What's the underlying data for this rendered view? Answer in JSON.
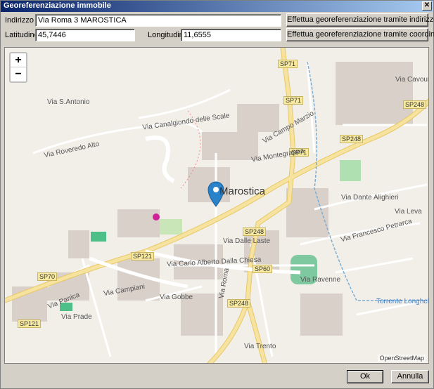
{
  "window": {
    "title": "Georeferenziazione immobile",
    "close_glyph": "✕"
  },
  "form": {
    "address_label": "Indirizzo",
    "address_value": "Via Roma 3 MAROSTICA",
    "lat_label": "Latitudine",
    "lat_value": "45,7446",
    "lon_label": "Longitudine",
    "lon_value": "11,6555",
    "geocode_address_button": "Effettua georeferenziazione tramite indirizzo",
    "geocode_coords_button": "Effettua georeferenziazione tramite coordinate"
  },
  "map": {
    "zoom_in": "+",
    "zoom_out": "−",
    "town": "Marostica",
    "attribution": "OpenStreetMap",
    "shields": [
      "SP71",
      "SP71",
      "SP71",
      "SP248",
      "SP248",
      "SP248",
      "SP248",
      "SP121",
      "SP121",
      "SP60",
      "SP70",
      "SP248"
    ],
    "streets": [
      "Via Roveredo Alto",
      "Via Canalgiondo delle Scale",
      "Via Panica",
      "Via Campiani",
      "Via Carlo Alberto Dalla Chiesa",
      "Via Roma",
      "Via Dalle Laste",
      "Via Montegrappa",
      "Via Campo Marzio",
      "Via Dante Alighieri",
      "Via Francesco Petrarca",
      "Via Leva",
      "Via Ravenne",
      "Via S.Antonio",
      "Via Cavour",
      "Torrente Longhella",
      "Via Gobbe",
      "Via Prade",
      "Via Trento"
    ],
    "colors": {
      "background": "#f2efe9",
      "primary_road": "#f7e3a0",
      "road": "#ffffff",
      "park": "#c8e6b8",
      "pitch": "#7fc9a0",
      "marker": "#2a82cb",
      "water": "#7aaed6"
    }
  },
  "dialog": {
    "ok_label": "Ok",
    "cancel_label": "Annulla"
  }
}
